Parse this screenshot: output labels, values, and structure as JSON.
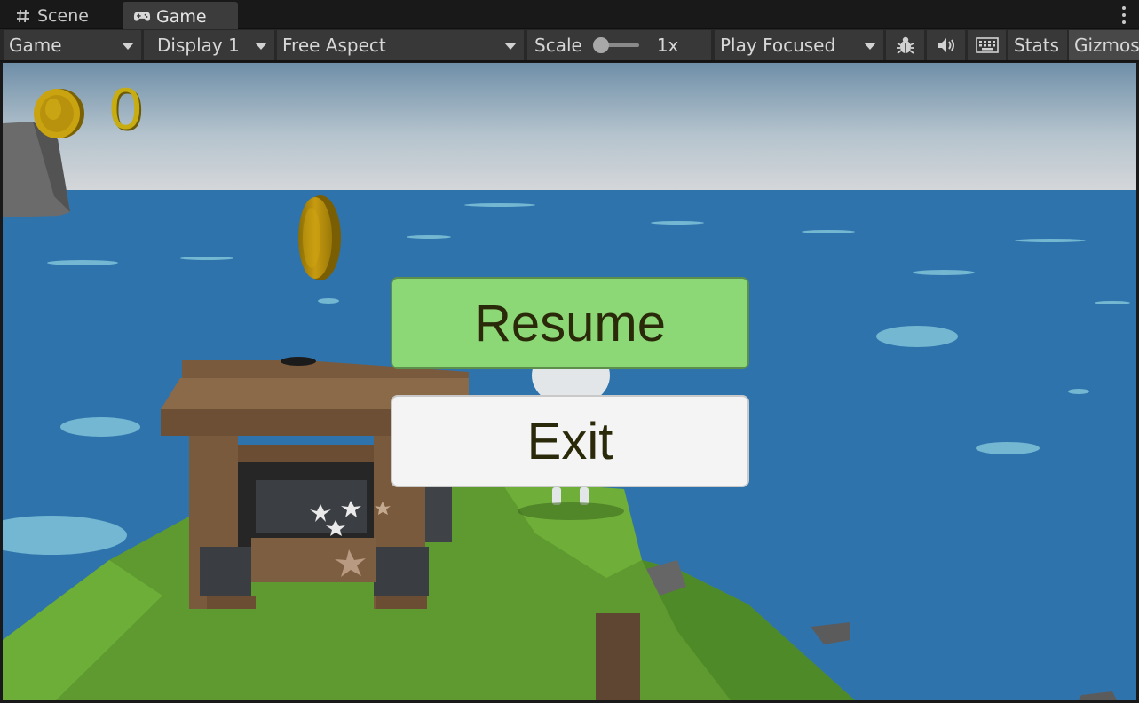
{
  "window": {
    "tabs": [
      {
        "label": "Scene",
        "icon": "hash-icon",
        "active": false
      },
      {
        "label": "Game",
        "icon": "gamepad-icon",
        "active": true
      }
    ]
  },
  "toolbar": {
    "mode_dropdown": "Game",
    "display_dropdown": "Display 1",
    "aspect_dropdown": "Free Aspect",
    "scale_label": "Scale",
    "scale_value": "1x",
    "play_mode_dropdown": "Play Focused",
    "stats_label": "Stats",
    "gizmos_label": "Gizmos",
    "icons": [
      "bug-icon",
      "audio-icon",
      "keyboard-icon"
    ]
  },
  "hud": {
    "coin_count": "0"
  },
  "pause_menu": {
    "resume_label": "Resume",
    "exit_label": "Exit"
  },
  "colors": {
    "resume_bg": "#8dd876",
    "exit_bg": "#f4f4f4",
    "coin": "#c7ad12",
    "ocean": "#2f73ad",
    "grass": "#5e9a2f"
  }
}
